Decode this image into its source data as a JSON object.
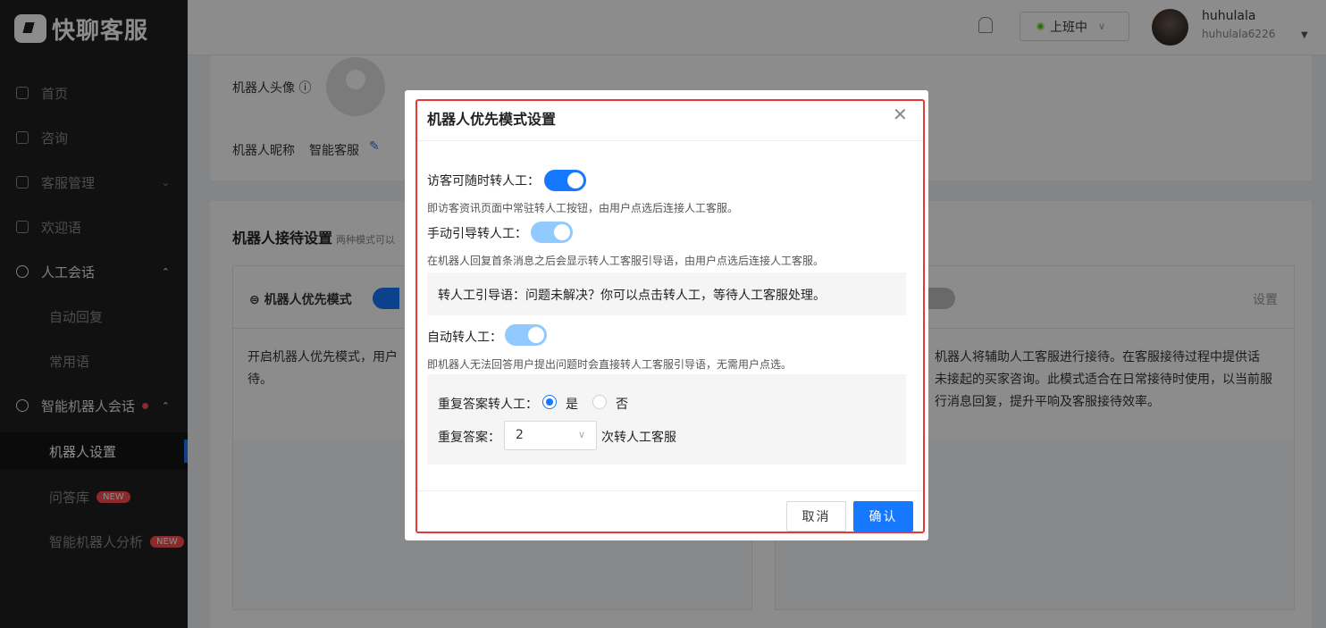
{
  "app": {
    "logo_text": "快聊客服"
  },
  "sidebar": {
    "items": [
      {
        "label": "首页"
      },
      {
        "label": "咨询"
      },
      {
        "label": "客服管理"
      },
      {
        "label": "欢迎语"
      },
      {
        "label": "人工会话"
      },
      {
        "label": "自动回复"
      },
      {
        "label": "常用语"
      },
      {
        "label": "智能机器人会话"
      },
      {
        "label": "机器人设置"
      },
      {
        "label": "问答库",
        "badge": "NEW"
      },
      {
        "label": "智能机器人分析",
        "badge": "NEW"
      }
    ]
  },
  "header": {
    "status": "上班中",
    "username": "huhulala",
    "userid": "huhulala6226"
  },
  "page": {
    "avatar_label": "机器人头像",
    "nickname_label": "机器人昵称",
    "nickname_value": "智能客服",
    "section_title": "机器人接待设置",
    "section_sub": "两种模式可以",
    "mode1_title": "机器人优先模式",
    "mode1_desc": "开启机器人优先模式，用户",
    "mode1_desc2": "待。",
    "mode2_setting": "设置",
    "mode2_desc1": "机器人将辅助人工客服进行接待。在客服接待过程中提供话",
    "mode2_desc2": "未接起的买家咨询。此模式适合在日常接待时使用，以当前服",
    "mode2_desc3": "行消息回复，提升平响及客服接待效率。"
  },
  "modal": {
    "title": "机器人优先模式设置",
    "opt1_label": "访客可随时转人工：",
    "opt1_hint": "即访客资讯页面中常驻转人工按钮，由用户点选后连接人工客服。",
    "opt2_label": "手动引导转人工：",
    "opt2_hint": "在机器人回复首条消息之后会显示转人工客服引导语，由用户点选后连接人工客服。",
    "guide_text": "转人工引导语：问题未解决？你可以点击转人工，等待人工客服处理。",
    "opt3_label": "自动转人工：",
    "opt3_hint": "即机器人无法回答用户提出问题时会直接转人工客服引导语，无需用户点选。",
    "repeat_label": "重复答案转人工：",
    "radio_yes": "是",
    "radio_no": "否",
    "repeat_count_label": "重复答案：",
    "repeat_count_value": "2",
    "repeat_count_suffix": "次转人工客服",
    "cancel": "取消",
    "confirm": "确认"
  }
}
